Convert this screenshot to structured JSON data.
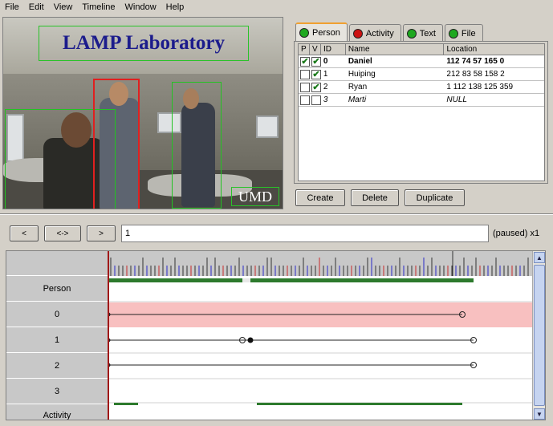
{
  "menu": [
    "File",
    "Edit",
    "View",
    "Timeline",
    "Window",
    "Help"
  ],
  "video": {
    "title_overlay": "LAMP Laboratory",
    "corner_label": "UMD"
  },
  "tabs": [
    {
      "label": "Person",
      "dot_color": "#1fa81f",
      "active": true
    },
    {
      "label": "Activity",
      "dot_color": "#cc1111",
      "active": false
    },
    {
      "label": "Text",
      "dot_color": "#1fa81f",
      "active": false
    },
    {
      "label": "File",
      "dot_color": "#1fa81f",
      "active": false
    }
  ],
  "table": {
    "headers": [
      "P",
      "V",
      "ID",
      "Name",
      "Location"
    ],
    "rows": [
      {
        "p": true,
        "v": true,
        "id": "0",
        "name": "Daniel",
        "location": "112 74 57 165 0",
        "bold": true
      },
      {
        "p": false,
        "v": true,
        "id": "1",
        "name": "Huiping",
        "location": "212 83 58 158 2"
      },
      {
        "p": false,
        "v": true,
        "id": "2",
        "name": "Ryan",
        "location": "1 112 138 125 359"
      },
      {
        "p": false,
        "v": false,
        "id": "3",
        "name": "Marti",
        "location": "NULL",
        "italic": true
      }
    ]
  },
  "actions": {
    "create": "Create",
    "delete": "Delete",
    "duplicate": "Duplicate"
  },
  "nav": {
    "prev": "<",
    "both": "<->",
    "next": ">",
    "frame_value": "1",
    "status": "(paused) x1"
  },
  "timeline": {
    "labels": [
      "Person",
      "0",
      "1",
      "2",
      "3",
      "Activity"
    ]
  },
  "colors": {
    "track_highlight": "#f8c0c0",
    "summary_bar": "#2d7a2d",
    "cursor": "#a01818"
  }
}
